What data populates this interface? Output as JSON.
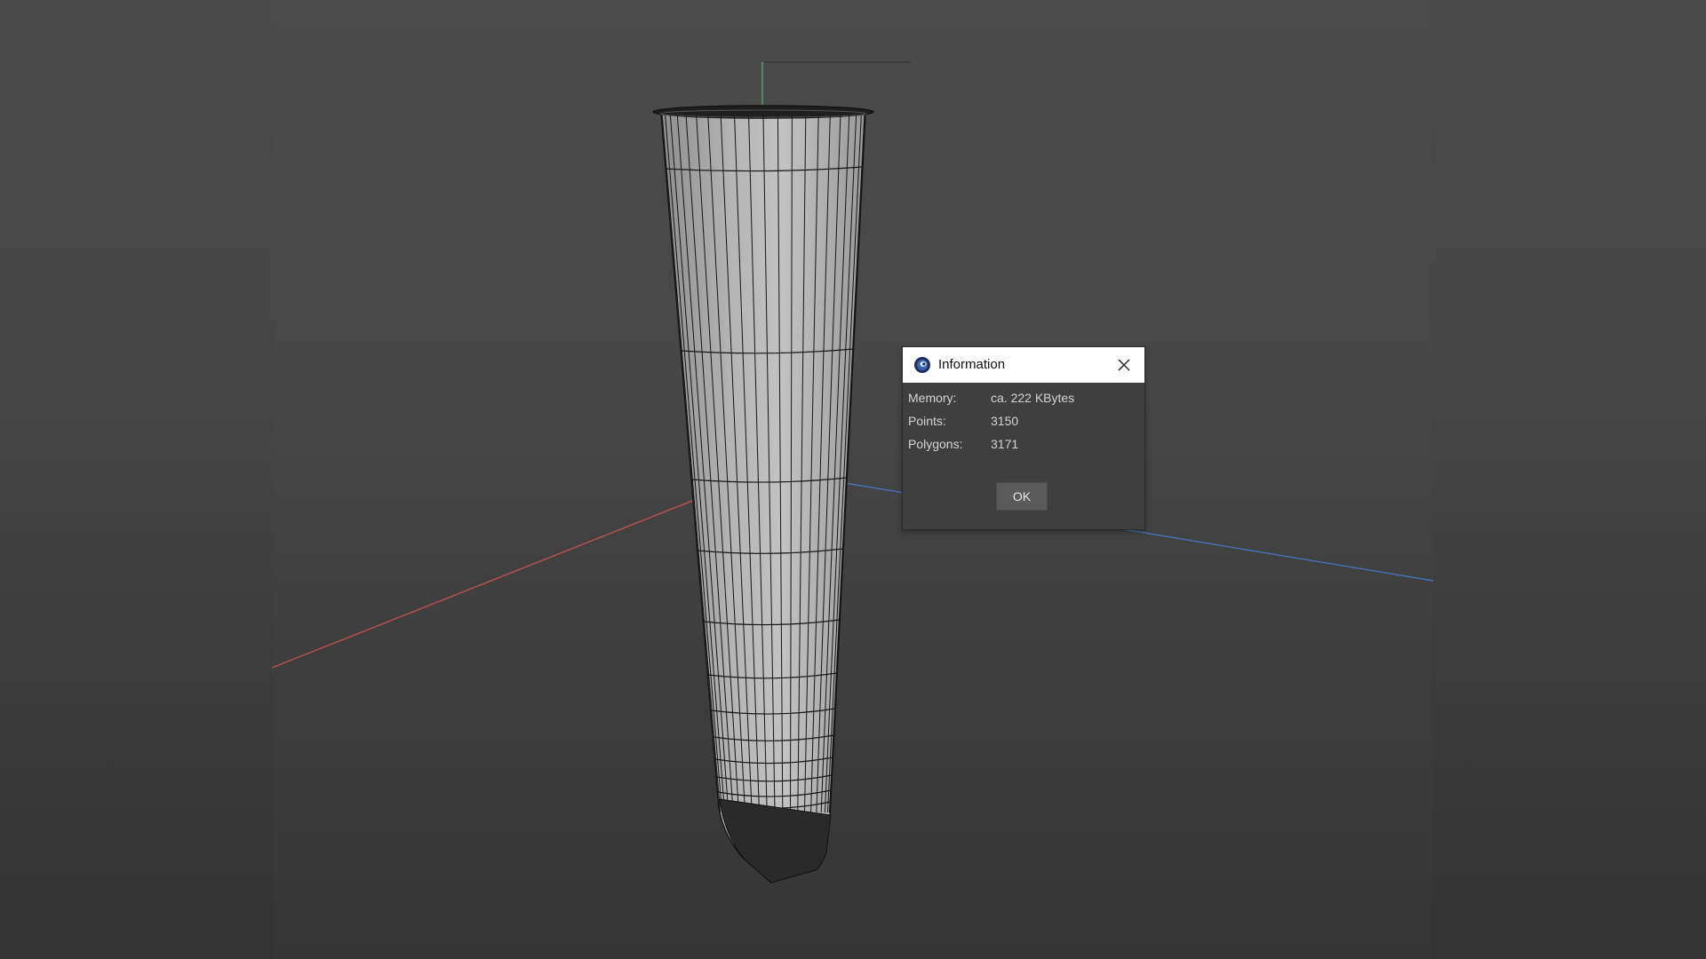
{
  "dialog": {
    "title": "Information",
    "rows": [
      {
        "label": "Memory:",
        "value": "ca. 222 KBytes"
      },
      {
        "label": "Points:",
        "value": "3150"
      },
      {
        "label": "Polygons:",
        "value": "3171"
      }
    ],
    "ok_label": "OK",
    "icons": {
      "app": "cinema4d-app-icon",
      "close": "close-icon"
    }
  },
  "viewport": {
    "axis_colors": {
      "x": "#c0504d",
      "y": "#4caf6a",
      "z": "#3f74b8"
    },
    "wire_color": "#151515",
    "surface_color": "#a8a8a8"
  }
}
